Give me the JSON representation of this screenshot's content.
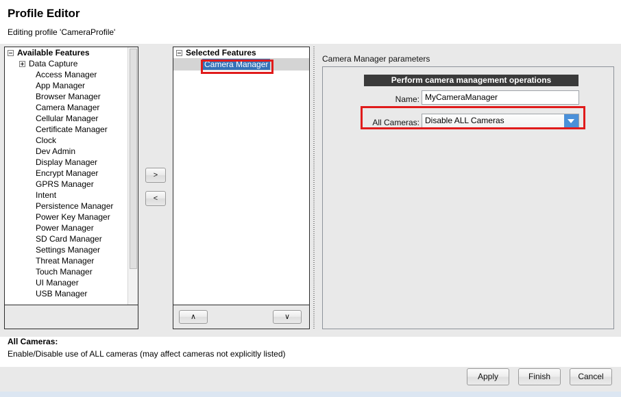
{
  "header": {
    "title": "Profile Editor",
    "subtitle": "Editing profile 'CameraProfile'"
  },
  "available": {
    "root_label": "Available Features",
    "root_toggle_icon": "minus-box-icon",
    "items": [
      {
        "label": "Data Capture",
        "expandable": true,
        "toggle_icon": "plus-box-icon"
      },
      {
        "label": "Access Manager",
        "expandable": false
      },
      {
        "label": "App Manager",
        "expandable": false
      },
      {
        "label": "Browser Manager",
        "expandable": false
      },
      {
        "label": "Camera Manager",
        "expandable": false
      },
      {
        "label": "Cellular Manager",
        "expandable": false
      },
      {
        "label": "Certificate Manager",
        "expandable": false
      },
      {
        "label": "Clock",
        "expandable": false
      },
      {
        "label": "Dev Admin",
        "expandable": false
      },
      {
        "label": "Display Manager",
        "expandable": false
      },
      {
        "label": "Encrypt Manager",
        "expandable": false
      },
      {
        "label": "GPRS Manager",
        "expandable": false
      },
      {
        "label": "Intent",
        "expandable": false
      },
      {
        "label": "Persistence Manager",
        "expandable": false
      },
      {
        "label": "Power Key Manager",
        "expandable": false
      },
      {
        "label": "Power Manager",
        "expandable": false
      },
      {
        "label": "SD Card Manager",
        "expandable": false
      },
      {
        "label": "Settings Manager",
        "expandable": false
      },
      {
        "label": "Threat Manager",
        "expandable": false
      },
      {
        "label": "Touch Manager",
        "expandable": false
      },
      {
        "label": "UI Manager",
        "expandable": false
      },
      {
        "label": "USB Manager",
        "expandable": false
      }
    ]
  },
  "transfer": {
    "add_label": ">",
    "remove_label": "<"
  },
  "selected": {
    "root_label": "Selected Features",
    "root_toggle_icon": "minus-box-icon",
    "items": [
      {
        "label": "Camera Manager",
        "selected": true
      }
    ],
    "move_up_label": "∧",
    "move_down_label": "∨"
  },
  "params": {
    "title": "Camera Manager parameters",
    "section_header": "Perform camera management operations",
    "name": {
      "label": "Name:",
      "value": "MyCameraManager"
    },
    "all_cameras": {
      "label": "All Cameras:",
      "value": "Disable ALL Cameras",
      "arrow_icon": "chevron-down-icon"
    }
  },
  "help": {
    "title": "All Cameras:",
    "text": "Enable/Disable use of ALL cameras (may affect cameras not explicitly listed)"
  },
  "buttons": {
    "apply": "Apply",
    "finish": "Finish",
    "cancel": "Cancel"
  },
  "colors": {
    "annotation_red": "#e01b1b",
    "selection_blue": "#3572b8",
    "dropdown_blue": "#4a90d9",
    "section_header_bg": "#3a3a3a"
  }
}
